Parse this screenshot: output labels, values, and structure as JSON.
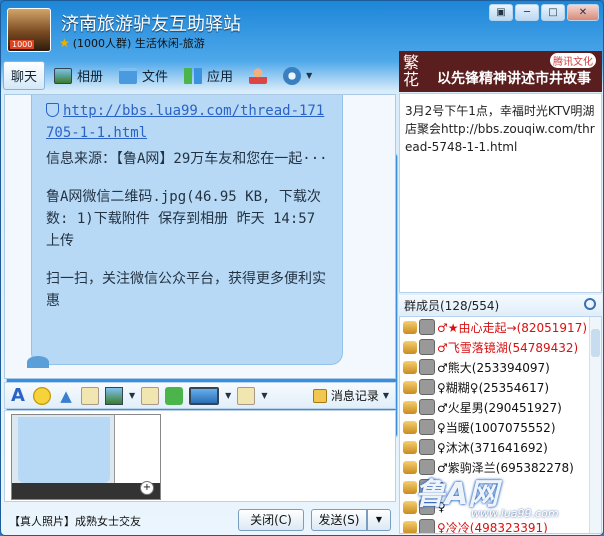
{
  "window": {
    "title": "济南旅游驴友互助驿站",
    "subtitle": "(1000人群) 生活休闲-旅游",
    "avatar_badge": "1000",
    "controls": [
      "▣",
      "─",
      "□",
      "✕"
    ]
  },
  "toolbar": {
    "tabs": [
      {
        "label": "聊天",
        "icon": "chat-icon",
        "active": true
      },
      {
        "label": "相册",
        "icon": "album-icon"
      },
      {
        "label": "文件",
        "icon": "folder-icon"
      },
      {
        "label": "应用",
        "icon": "apps-icon"
      }
    ]
  },
  "chat": {
    "link": "http://bbs.lua99.com/thread-171705-1-1.html",
    "source_text": "信息来源：【鲁A网】29万车友和您在一起···",
    "file_text": "鲁A网微信二维码.jpg(46.95 KB, 下载次数: 1)下载附件 保存到相册 昨天 14:57上传",
    "promo_text": "扫一扫，关注微信公众平台，获得更多便利实惠"
  },
  "banner": {
    "brush_text": "繁花",
    "slogan": "以先锋精神讲述市井故事",
    "brand": "腾讯文化"
  },
  "notice": {
    "text": "3月2号下午1点，幸福时光KTV明湖店聚会http://bbs.zouqiw.com/thread-5748-1-1.html"
  },
  "members": {
    "header": "群成员(128/554)",
    "list": [
      {
        "name": "♂★由心走起→(82051917)",
        "red": true
      },
      {
        "name": "♂飞雪落镜湖(54789432)",
        "red": true
      },
      {
        "name": "♂熊大(253394097)",
        "red": false
      },
      {
        "name": "♀糊糊♀(25354617)",
        "red": false
      },
      {
        "name": "♂火星男(290451927)",
        "red": false
      },
      {
        "name": "♀当暖(1007075552)",
        "red": false
      },
      {
        "name": "♀沐沐(371641692)",
        "red": false
      },
      {
        "name": "♂紫驹泽兰(695382278)",
        "red": false
      },
      {
        "name": "♀",
        "red": false
      },
      {
        "name": "♀",
        "red": false
      },
      {
        "name": "♀冷冷(498323391)",
        "red": true
      }
    ]
  },
  "watermark": {
    "logo": "鲁A网",
    "url": "www.lua99.com"
  },
  "input_toolbar": {
    "history_label": "消息记录"
  },
  "footer": {
    "ad_text": "【真人照片】成熟女士交友",
    "close_label": "关闭(C)",
    "send_label": "发送(S)"
  }
}
